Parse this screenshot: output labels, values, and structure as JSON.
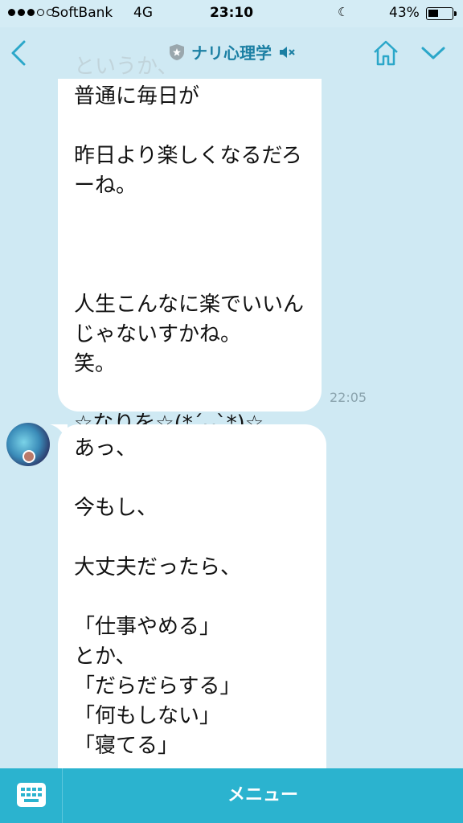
{
  "status_bar": {
    "carrier": "SoftBank",
    "network": "4G",
    "time": "23:10",
    "battery_percent": "43%",
    "battery_level": 0.43,
    "icons": [
      "moon-icon",
      "rotation-lock-icon",
      "location-icon",
      "bluetooth-icon"
    ]
  },
  "header": {
    "title": "ナリ心理学",
    "back_icon": "chevron-left-icon",
    "home_icon": "home-icon",
    "more_icon": "chevron-down-icon",
    "official_icon": "shield-star-icon",
    "mute_icon": "speaker-muted-icon"
  },
  "faded_text": "というか、",
  "messages": [
    {
      "text": "普通に毎日が\n\n昨日より楽しくなるだろーね。\n\n\n\n人生こんなに楽でいいんじゃないすかね。\n笑。\n\n☆なりを☆(*ˊ̤ᴗˋ̤*)☆",
      "time": "22:05"
    },
    {
      "text": "あっ、\n\n今もし、\n\n大丈夫だったら、\n\n「仕事やめる」\nとか、\n「だらだらする」\n「何もしない」\n「寝てる」"
    }
  ],
  "menu_bar": {
    "label": "メニュー",
    "keyboard_icon": "keyboard-icon"
  },
  "colors": {
    "background": "#cfe9f3",
    "accent": "#2bb3cf",
    "title": "#1b7fa3"
  }
}
